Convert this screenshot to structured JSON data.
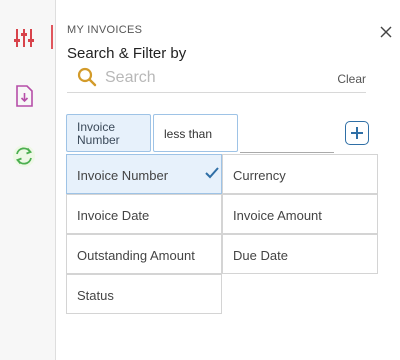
{
  "rail": {
    "items": [
      {
        "icon": "sliders-icon",
        "active": true
      },
      {
        "icon": "document-download-icon",
        "active": false
      },
      {
        "icon": "refresh-icon",
        "active": false
      }
    ]
  },
  "panel": {
    "eyebrow": "MY INVOICES",
    "title": "Search & Filter by",
    "close_icon": "close-icon"
  },
  "search": {
    "placeholder": "Search",
    "value": "",
    "clear_label": "Clear"
  },
  "filter": {
    "field": "Invoice Number",
    "operator": "less than",
    "value": "",
    "add_icon": "plus-icon"
  },
  "options": [
    {
      "label": "Invoice Number",
      "selected": true
    },
    {
      "label": "Currency",
      "selected": false
    },
    {
      "label": "Invoice Date",
      "selected": false
    },
    {
      "label": "Invoice Amount",
      "selected": false
    },
    {
      "label": "Outstanding Amount",
      "selected": false
    },
    {
      "label": "Due Date",
      "selected": false
    },
    {
      "label": "Status",
      "selected": false
    }
  ],
  "colors": {
    "accent_red": "#e0565d",
    "accent_blue": "#2f6fa6",
    "selected_bg": "#e7f1fb",
    "search_icon": "#d39b2a",
    "refresh_icon": "#4caf50",
    "download_icon": "#b64ea8"
  }
}
